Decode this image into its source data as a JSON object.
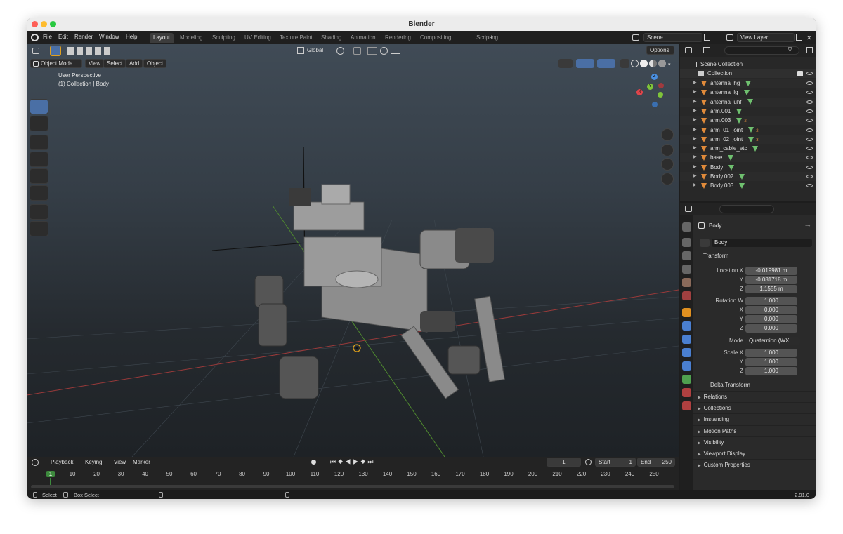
{
  "window": {
    "title": "Blender"
  },
  "menu": [
    "File",
    "Edit",
    "Render",
    "Window",
    "Help"
  ],
  "workspaces": [
    {
      "label": "Layout",
      "active": true
    },
    {
      "label": "Modeling",
      "active": false
    },
    {
      "label": "Sculpting",
      "active": false
    },
    {
      "label": "UV Editing",
      "active": false
    },
    {
      "label": "Texture Paint",
      "active": false
    },
    {
      "label": "Shading",
      "active": false
    },
    {
      "label": "Animation",
      "active": false
    },
    {
      "label": "Rendering",
      "active": false
    },
    {
      "label": "Compositing",
      "active": false
    },
    {
      "label": "Scripting",
      "active": false
    }
  ],
  "add_workspace": "+",
  "scene": "Scene",
  "view_layer": "View Layer",
  "viewport": {
    "transform_orientation": "Global",
    "options_label": "Options",
    "mode": "Object Mode",
    "menus": [
      "View",
      "Select",
      "Add",
      "Object"
    ],
    "overlay_line1": "User Perspective",
    "overlay_line2": "(1) Collection | Body",
    "gizmo_axes": {
      "x": "X",
      "y": "Y",
      "z": "Z"
    }
  },
  "outliner": {
    "root": "Scene Collection",
    "collection": "Collection",
    "items": [
      {
        "name": "antenna_hg",
        "badge": ""
      },
      {
        "name": "antenna_lg",
        "badge": ""
      },
      {
        "name": "antenna_uhf",
        "badge": ""
      },
      {
        "name": "arm.001",
        "badge": ""
      },
      {
        "name": "arm.003",
        "badge": "2"
      },
      {
        "name": "arm_01_joint",
        "badge": "2"
      },
      {
        "name": "arm_02_joint",
        "badge": "3"
      },
      {
        "name": "arm_cable_etc",
        "badge": ""
      },
      {
        "name": "base",
        "badge": ""
      },
      {
        "name": "Body",
        "badge": ""
      },
      {
        "name": "Body.002",
        "badge": ""
      },
      {
        "name": "Body.003",
        "badge": ""
      }
    ]
  },
  "properties": {
    "object_name": "Body",
    "object_field": "Body",
    "transform_title": "Transform",
    "location": {
      "label": "Location X",
      "x": "-0.019981 m",
      "y": "-0.081718 m",
      "z": "1.1555 m"
    },
    "rotation": {
      "label": "Rotation W",
      "w": "1.000",
      "x": "0.000",
      "y": "0.000",
      "z": "0.000"
    },
    "mode_label": "Mode",
    "mode_value": "Quaternion (WX...",
    "scale": {
      "label": "Scale X",
      "x": "1.000",
      "y": "1.000",
      "z": "1.000"
    },
    "axis_labels": {
      "x": "X",
      "y": "Y",
      "z": "Z"
    },
    "delta": "Delta Transform",
    "sections": [
      "Relations",
      "Collections",
      "Instancing",
      "Motion Paths",
      "Visibility",
      "Viewport Display",
      "Custom Properties"
    ]
  },
  "timeline": {
    "menus": [
      "Playback",
      "Keying",
      "View",
      "Marker"
    ],
    "current_frame": "1",
    "start_label": "Start",
    "start": "1",
    "end_label": "End",
    "end": "250",
    "ticks": [
      "1",
      "10",
      "20",
      "30",
      "40",
      "50",
      "60",
      "70",
      "80",
      "90",
      "100",
      "110",
      "120",
      "130",
      "140",
      "150",
      "160",
      "170",
      "180",
      "190",
      "200",
      "210",
      "220",
      "230",
      "240",
      "250"
    ]
  },
  "status": {
    "select": "Select",
    "box_select": "Box Select",
    "version": "2.91.0"
  },
  "colors": {
    "accent": "#4a6fa5",
    "active_frame": "#3d8a3d",
    "x_axis": "#e0454b",
    "y_axis": "#7fc43a",
    "z_axis": "#4a8fe0"
  }
}
